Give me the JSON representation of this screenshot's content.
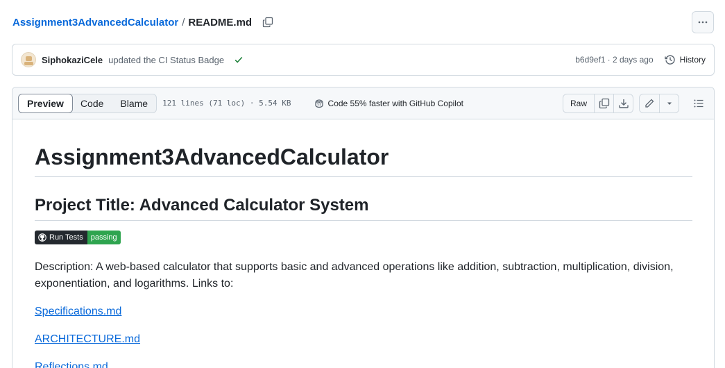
{
  "breadcrumb": {
    "repo": "Assignment3AdvancedCalculator",
    "separator": "/",
    "file": "README.md"
  },
  "commit": {
    "author": "SiphokaziCele",
    "message": "updated the CI Status Badge",
    "sha": "b6d9ef1",
    "time": "· 2 days ago",
    "history_label": "History"
  },
  "file_header": {
    "tabs": [
      "Preview",
      "Code",
      "Blame"
    ],
    "meta": "121 lines (71 loc) · 5.54 KB",
    "copilot": "Code 55% faster with GitHub Copilot",
    "raw_label": "Raw"
  },
  "readme": {
    "h1": "Assignment3AdvancedCalculator",
    "h2": "Project Title: Advanced Calculator System",
    "badge": {
      "label": "Run Tests",
      "status": "passing"
    },
    "description": "Description: A web-based calculator that supports basic and advanced operations like addition, subtraction, multiplication, division, exponentiation, and logarithms. Links to:",
    "links": [
      "Specifications.md",
      "ARCHITECTURE.md",
      "Reflections.md"
    ]
  },
  "colors": {
    "link": "#0969da",
    "success": "#1a7f37",
    "badge_pass": "#2ea44f"
  }
}
